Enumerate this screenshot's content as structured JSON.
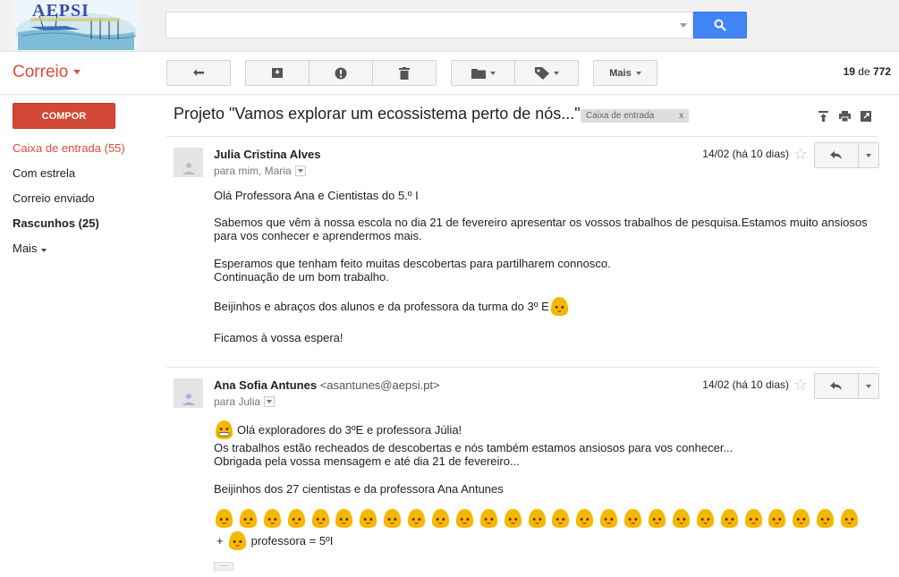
{
  "header": {
    "logo_text": "AEPSI",
    "search": {
      "value": "",
      "placeholder": ""
    }
  },
  "toolbar": {
    "app_title": "Correio",
    "more_label": "Mais",
    "pager": {
      "current": "19",
      "of": "de",
      "total": "772"
    }
  },
  "sidebar": {
    "compose_label": "COMPOR",
    "items": [
      {
        "label": "Caixa de entrada (55)",
        "state": "active"
      },
      {
        "label": "Com estrela",
        "state": "normal"
      },
      {
        "label": "Correio enviado",
        "state": "normal"
      },
      {
        "label": "Rascunhos (25)",
        "state": "bold"
      },
      {
        "label": "Mais",
        "state": "dropdown"
      }
    ]
  },
  "thread": {
    "subject": "Projeto \"Vamos explorar um ecossistema perto de nós...\"",
    "label": "Caixa de entrada",
    "label_remove": "x"
  },
  "messages": [
    {
      "sender": "Julia Cristina Alves",
      "email": "",
      "recipients": "para mim, Maria",
      "date": "14/02 (há 10 dias)",
      "lines": {
        "l1": "Olá Professora Ana e Cientistas do 5.º I",
        "l2": "Sabemos que vêm à nossa escola no dia 21 de fevereiro apresentar os vossos trabalhos de pesquisa.Estamos muito ansiosos",
        "l3": "para vos conhecer e aprendermos mais.",
        "l4": "Esperamos que tenham feito muitas descobertas para partilharem connosco.",
        "l5": "Continuação de um bom trabalho.",
        "l6": "Beijinhos e abraços dos alunos e da professora da turma do 3º E",
        "l7": "Ficamos à vossa espera!"
      }
    },
    {
      "sender": "Ana Sofia Antunes",
      "email": "<asantunes@aepsi.pt>",
      "recipients": "para Julia",
      "date": "14/02 (há 10 dias)",
      "lines": {
        "l1": "Olá exploradores do 3ºE e professora Júlia!",
        "l2": "Os trabalhos estão recheados de descobertas e nós também estamos ansiosos para vos conhecer...",
        "l3": "Obrigada pela vossa mensagem e até dia 21 de fevereiro...",
        "l4": "Beijinhos dos 27 cientistas e da  professora Ana Antunes",
        "l5_prefix": "+",
        "l5_suffix": "professora = 5ºI"
      },
      "emoji_count": 27,
      "trimmed_label": "···"
    }
  ],
  "colors": {
    "accent_red": "#dd4b39",
    "compose_red": "#d14836",
    "search_blue": "#4285f4",
    "emoji_yellow": "#f5b800"
  }
}
